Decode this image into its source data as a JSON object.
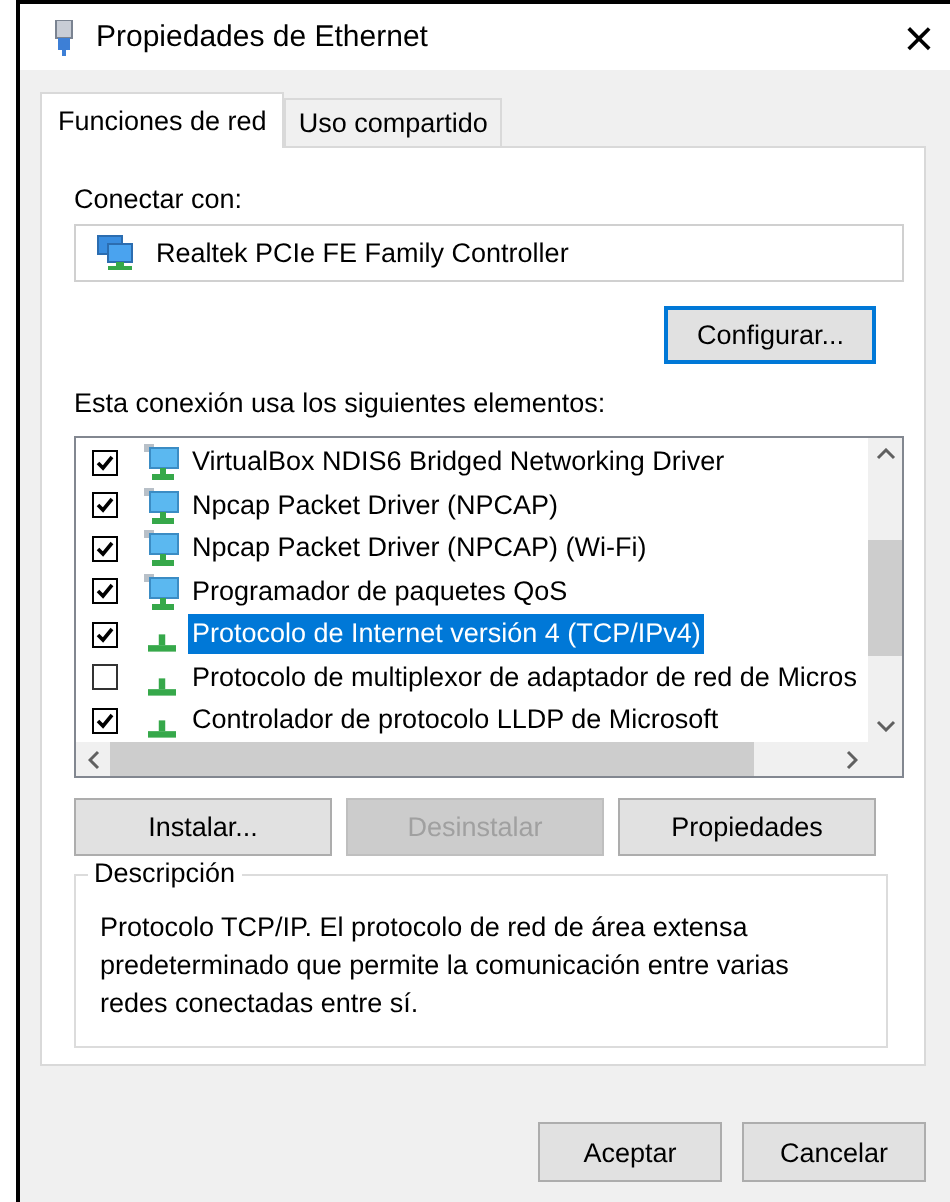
{
  "window": {
    "title": "Propiedades de Ethernet",
    "close": "×"
  },
  "tabs": [
    {
      "label": "Funciones de red",
      "selected": true
    },
    {
      "label": "Uso compartido",
      "selected": false
    }
  ],
  "connect_label": "Conectar con:",
  "adapter": "Realtek PCIe FE Family Controller",
  "configure_button": {
    "label": "Configurar...",
    "disabled": false
  },
  "items_label": "Esta conexión usa los siguientes elementos:",
  "items": [
    {
      "kind": "service",
      "label": "VirtualBox NDIS6 Bridged Networking Driver",
      "checked": true,
      "selected": false
    },
    {
      "kind": "service",
      "label": "Npcap Packet Driver (NPCAP)",
      "checked": true,
      "selected": false
    },
    {
      "kind": "service",
      "label": "Npcap Packet Driver (NPCAP) (Wi-Fi)",
      "checked": true,
      "selected": false
    },
    {
      "kind": "service",
      "label": "Programador de paquetes QoS",
      "checked": true,
      "selected": false
    },
    {
      "kind": "protocol",
      "label": "Protocolo de Internet versión 4 (TCP/IPv4)",
      "checked": true,
      "selected": true
    },
    {
      "kind": "protocol",
      "label": "Protocolo de multiplexor de adaptador de red de Micros",
      "checked": false,
      "selected": false
    },
    {
      "kind": "protocol",
      "label": "Controlador de protocolo LLDP de Microsoft",
      "checked": true,
      "selected": false
    }
  ],
  "action_buttons": [
    {
      "label": "Instalar...",
      "disabled": false
    },
    {
      "label": "Desinstalar",
      "disabled": true
    },
    {
      "label": "Propiedades",
      "disabled": false
    }
  ],
  "description": {
    "title": "Descripción",
    "text": "Protocolo TCP/IP. El protocolo de red de área extensa predeterminado que permite la comunicación entre varias redes conectadas entre sí."
  },
  "dialog_buttons": [
    {
      "label": "Aceptar",
      "disabled": false
    },
    {
      "label": "Cancelar",
      "disabled": false
    }
  ]
}
